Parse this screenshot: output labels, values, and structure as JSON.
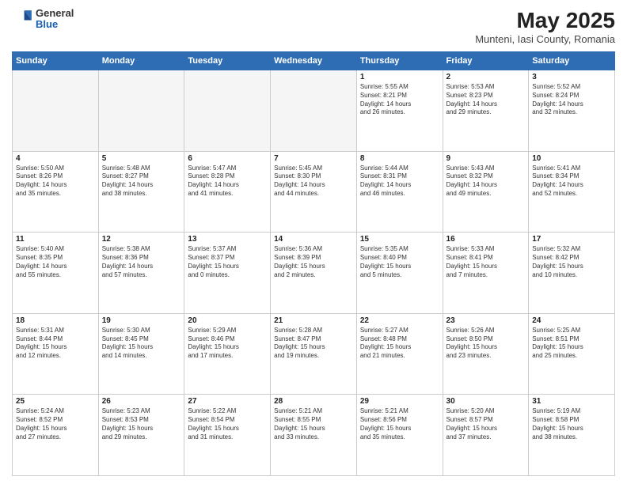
{
  "header": {
    "logo_general": "General",
    "logo_blue": "Blue",
    "month_title": "May 2025",
    "location": "Munteni, Iasi County, Romania"
  },
  "weekdays": [
    "Sunday",
    "Monday",
    "Tuesday",
    "Wednesday",
    "Thursday",
    "Friday",
    "Saturday"
  ],
  "weeks": [
    [
      {
        "day": "",
        "info": ""
      },
      {
        "day": "",
        "info": ""
      },
      {
        "day": "",
        "info": ""
      },
      {
        "day": "",
        "info": ""
      },
      {
        "day": "1",
        "info": "Sunrise: 5:55 AM\nSunset: 8:21 PM\nDaylight: 14 hours\nand 26 minutes."
      },
      {
        "day": "2",
        "info": "Sunrise: 5:53 AM\nSunset: 8:23 PM\nDaylight: 14 hours\nand 29 minutes."
      },
      {
        "day": "3",
        "info": "Sunrise: 5:52 AM\nSunset: 8:24 PM\nDaylight: 14 hours\nand 32 minutes."
      }
    ],
    [
      {
        "day": "4",
        "info": "Sunrise: 5:50 AM\nSunset: 8:26 PM\nDaylight: 14 hours\nand 35 minutes."
      },
      {
        "day": "5",
        "info": "Sunrise: 5:48 AM\nSunset: 8:27 PM\nDaylight: 14 hours\nand 38 minutes."
      },
      {
        "day": "6",
        "info": "Sunrise: 5:47 AM\nSunset: 8:28 PM\nDaylight: 14 hours\nand 41 minutes."
      },
      {
        "day": "7",
        "info": "Sunrise: 5:45 AM\nSunset: 8:30 PM\nDaylight: 14 hours\nand 44 minutes."
      },
      {
        "day": "8",
        "info": "Sunrise: 5:44 AM\nSunset: 8:31 PM\nDaylight: 14 hours\nand 46 minutes."
      },
      {
        "day": "9",
        "info": "Sunrise: 5:43 AM\nSunset: 8:32 PM\nDaylight: 14 hours\nand 49 minutes."
      },
      {
        "day": "10",
        "info": "Sunrise: 5:41 AM\nSunset: 8:34 PM\nDaylight: 14 hours\nand 52 minutes."
      }
    ],
    [
      {
        "day": "11",
        "info": "Sunrise: 5:40 AM\nSunset: 8:35 PM\nDaylight: 14 hours\nand 55 minutes."
      },
      {
        "day": "12",
        "info": "Sunrise: 5:38 AM\nSunset: 8:36 PM\nDaylight: 14 hours\nand 57 minutes."
      },
      {
        "day": "13",
        "info": "Sunrise: 5:37 AM\nSunset: 8:37 PM\nDaylight: 15 hours\nand 0 minutes."
      },
      {
        "day": "14",
        "info": "Sunrise: 5:36 AM\nSunset: 8:39 PM\nDaylight: 15 hours\nand 2 minutes."
      },
      {
        "day": "15",
        "info": "Sunrise: 5:35 AM\nSunset: 8:40 PM\nDaylight: 15 hours\nand 5 minutes."
      },
      {
        "day": "16",
        "info": "Sunrise: 5:33 AM\nSunset: 8:41 PM\nDaylight: 15 hours\nand 7 minutes."
      },
      {
        "day": "17",
        "info": "Sunrise: 5:32 AM\nSunset: 8:42 PM\nDaylight: 15 hours\nand 10 minutes."
      }
    ],
    [
      {
        "day": "18",
        "info": "Sunrise: 5:31 AM\nSunset: 8:44 PM\nDaylight: 15 hours\nand 12 minutes."
      },
      {
        "day": "19",
        "info": "Sunrise: 5:30 AM\nSunset: 8:45 PM\nDaylight: 15 hours\nand 14 minutes."
      },
      {
        "day": "20",
        "info": "Sunrise: 5:29 AM\nSunset: 8:46 PM\nDaylight: 15 hours\nand 17 minutes."
      },
      {
        "day": "21",
        "info": "Sunrise: 5:28 AM\nSunset: 8:47 PM\nDaylight: 15 hours\nand 19 minutes."
      },
      {
        "day": "22",
        "info": "Sunrise: 5:27 AM\nSunset: 8:48 PM\nDaylight: 15 hours\nand 21 minutes."
      },
      {
        "day": "23",
        "info": "Sunrise: 5:26 AM\nSunset: 8:50 PM\nDaylight: 15 hours\nand 23 minutes."
      },
      {
        "day": "24",
        "info": "Sunrise: 5:25 AM\nSunset: 8:51 PM\nDaylight: 15 hours\nand 25 minutes."
      }
    ],
    [
      {
        "day": "25",
        "info": "Sunrise: 5:24 AM\nSunset: 8:52 PM\nDaylight: 15 hours\nand 27 minutes."
      },
      {
        "day": "26",
        "info": "Sunrise: 5:23 AM\nSunset: 8:53 PM\nDaylight: 15 hours\nand 29 minutes."
      },
      {
        "day": "27",
        "info": "Sunrise: 5:22 AM\nSunset: 8:54 PM\nDaylight: 15 hours\nand 31 minutes."
      },
      {
        "day": "28",
        "info": "Sunrise: 5:21 AM\nSunset: 8:55 PM\nDaylight: 15 hours\nand 33 minutes."
      },
      {
        "day": "29",
        "info": "Sunrise: 5:21 AM\nSunset: 8:56 PM\nDaylight: 15 hours\nand 35 minutes."
      },
      {
        "day": "30",
        "info": "Sunrise: 5:20 AM\nSunset: 8:57 PM\nDaylight: 15 hours\nand 37 minutes."
      },
      {
        "day": "31",
        "info": "Sunrise: 5:19 AM\nSunset: 8:58 PM\nDaylight: 15 hours\nand 38 minutes."
      }
    ]
  ]
}
